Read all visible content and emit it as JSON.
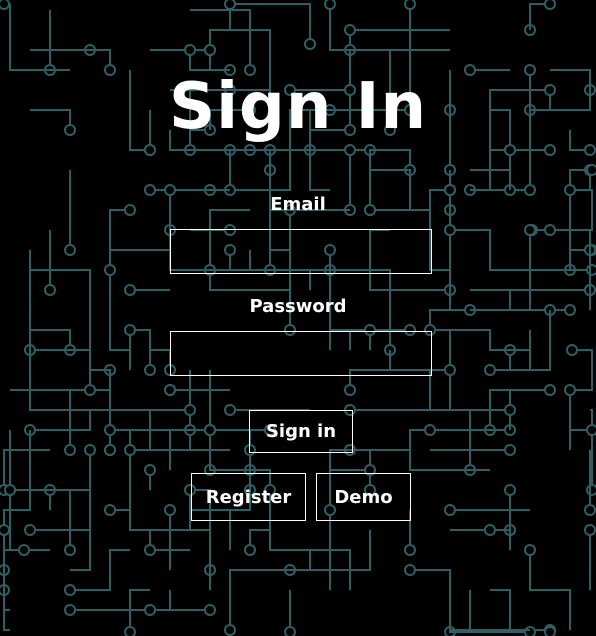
{
  "signin": {
    "title": "Sign In",
    "email_label": "Email",
    "email_value": "",
    "password_label": "Password",
    "password_value": "",
    "signin_button": "Sign in",
    "register_button": "Register",
    "demo_button": "Demo"
  },
  "colors": {
    "background": "#000000",
    "circuit_trace": "#2f5f63",
    "text": "#ffffff"
  }
}
